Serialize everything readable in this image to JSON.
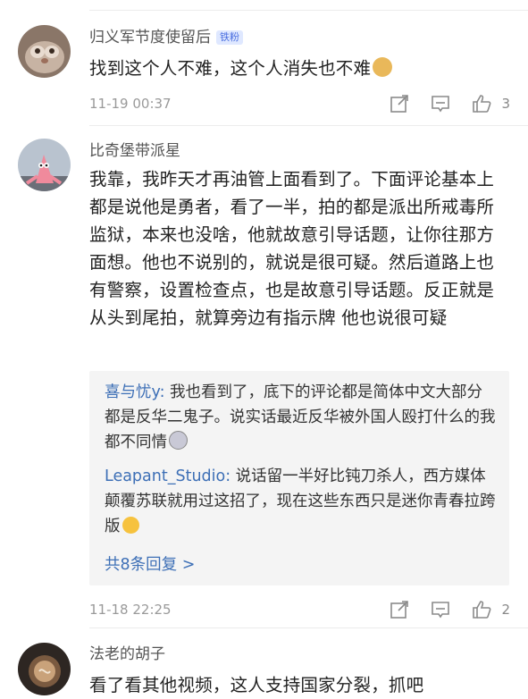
{
  "comments": [
    {
      "username": "归义军节度使留后",
      "badge": "铁粉",
      "text": "找到这个人不难，这个人消失也不难",
      "emoji": "doge-emoji",
      "time": "11-19 00:37",
      "likes": "3"
    },
    {
      "username": "比奇堡带派星",
      "text": "我靠，我昨天才再油管上面看到了。下面评论基本上都是说他是勇者，看了一半，拍的都是派出所戒毒所监狱，本来也没啥，他就故意引导话题，让你往那方面想。他也不说别的，就说是很可疑。然后道路上也有警察，设置检查点，也是故意引导话题。反正就是从头到尾拍，就算旁边有指示牌 他也说很可疑",
      "replies": [
        {
          "name": "喜与忧y:",
          "text": " 我也看到了，底下的评论都是简体中文大部分都是反华二鬼子。说实话最近反华被外国人殴打什么的我都不同情",
          "emoji": "crazy-face-emoji"
        },
        {
          "name": "Leapant_Studio:",
          "text": " 说话留一半好比钝刀杀人，西方媒体颠覆苏联就用过这招了，现在这些东西只是迷你青春拉跨版",
          "emoji": "tongue-face-emoji"
        }
      ],
      "more_replies": "共8条回复 >",
      "time": "11-18 22:25",
      "likes": "2"
    },
    {
      "username": "法老的胡子",
      "text": "看了看其他视频，这人支持国家分裂，抓吧"
    }
  ],
  "colors": {
    "link": "#3d6fb6",
    "badge_bg": "#dfe8ff",
    "reply_bg": "#f4f4f4"
  }
}
